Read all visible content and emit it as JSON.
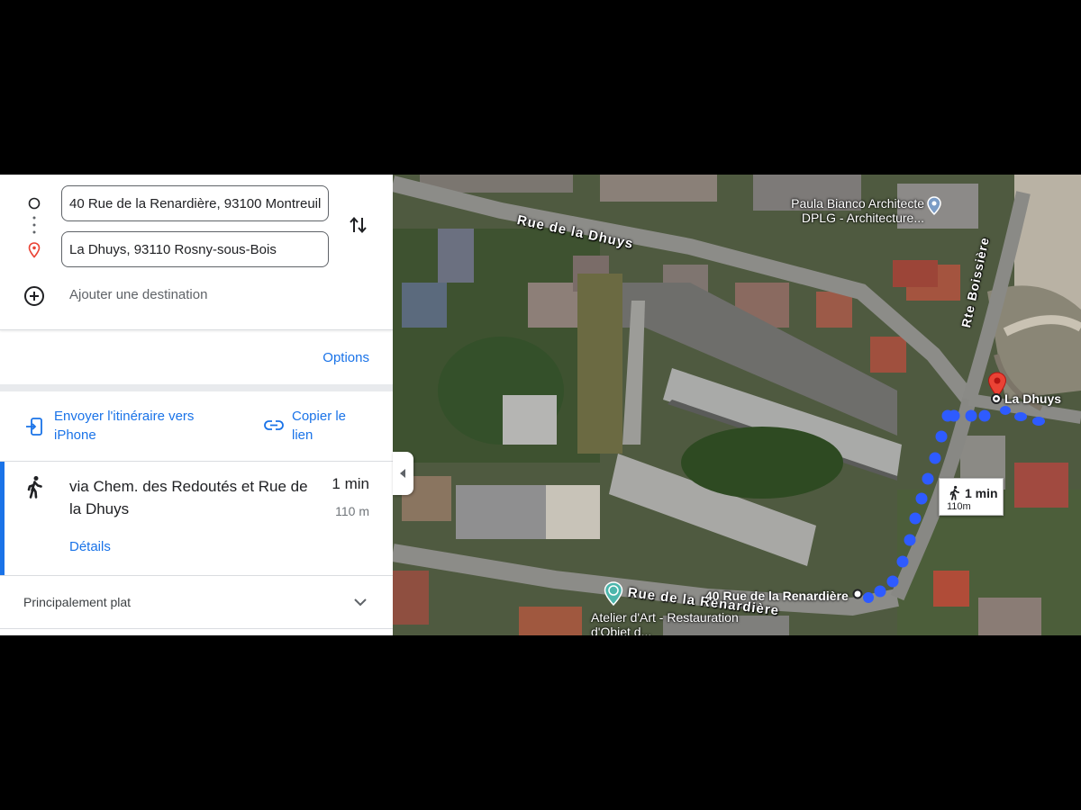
{
  "directions": {
    "origin": "40 Rue de la Renardière, 93100 Montreuil",
    "destination": "La Dhuys, 93110 Rosny-sous-Bois",
    "add_destination": "Ajouter une destination",
    "options_label": "Options"
  },
  "share": {
    "send_label": "Envoyer l'itinéraire vers iPhone",
    "copy_label": "Copier le lien"
  },
  "route": {
    "mode_icon": "walk-icon",
    "title": "via Chem. des Redoutés et Rue de la Dhuys",
    "time": "1 min",
    "distance": "110 m",
    "details_label": "Détails"
  },
  "terrain": {
    "label": "Principalement plat"
  },
  "map": {
    "streets": [
      "Rue de la Dhuys",
      "Rue de la Renardière",
      "Rte Boissière"
    ],
    "pois": [
      {
        "name": "Paula Bianco Architecte DPLG - Architecture...",
        "icon": "pin-icon"
      },
      {
        "name": "Atelier d'Art - Restauration d'Objet d...",
        "icon": "palette-icon"
      }
    ],
    "origin_label": "40 Rue de la Renardière",
    "destination_label": "La Dhuys",
    "walk_time": "1 min",
    "walk_distance": "110m"
  },
  "colors": {
    "accent": "#1a73e8",
    "route_dots": "#2e5bff",
    "destination_pin": "#ea4335"
  }
}
